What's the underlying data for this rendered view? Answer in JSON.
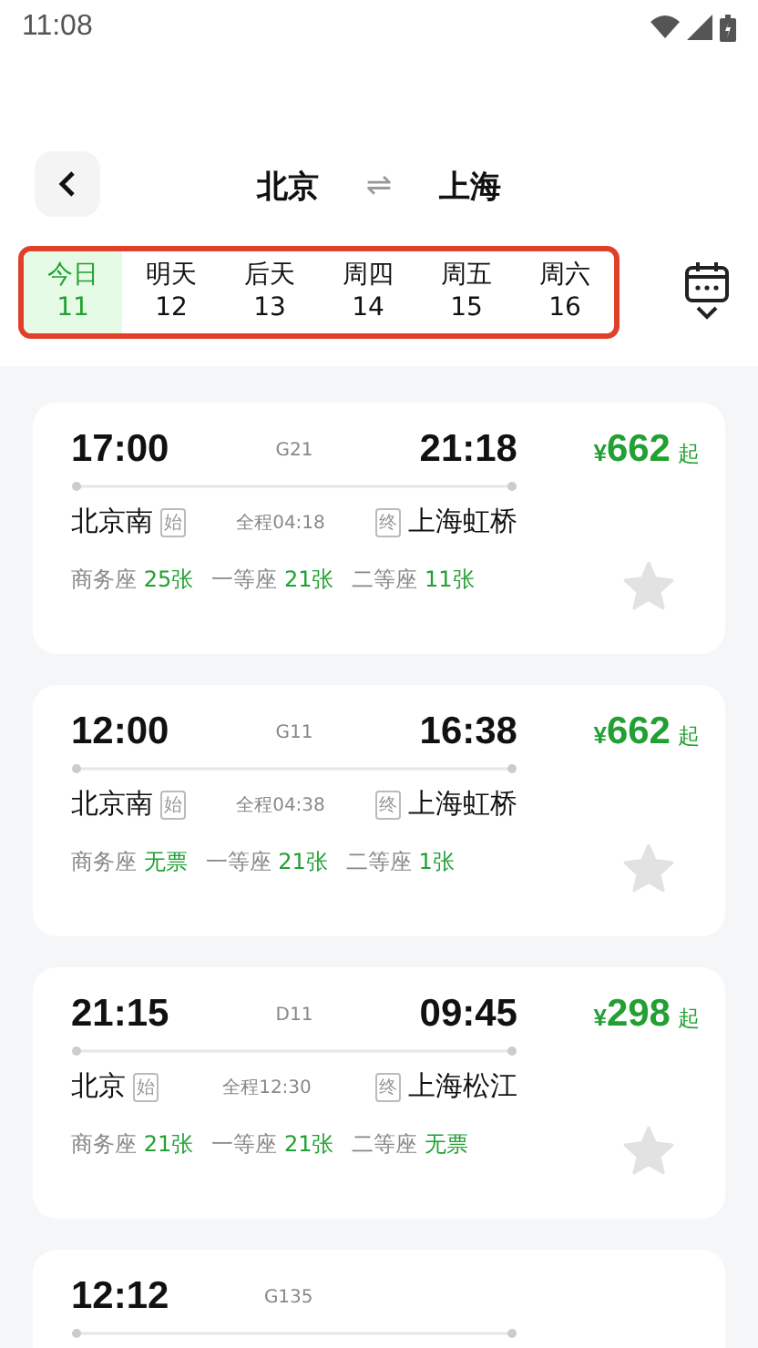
{
  "status_bar": {
    "time": "11:08"
  },
  "header": {
    "from": "北京",
    "swap": "⇌",
    "to": "上海"
  },
  "dates": [
    {
      "day": "今日",
      "date": "11",
      "selected": true
    },
    {
      "day": "明天",
      "date": "12",
      "selected": false
    },
    {
      "day": "后天",
      "date": "13",
      "selected": false
    },
    {
      "day": "周四",
      "date": "14",
      "selected": false
    },
    {
      "day": "周五",
      "date": "15",
      "selected": false
    },
    {
      "day": "周六",
      "date": "16",
      "selected": false
    }
  ],
  "trains": [
    {
      "depart": "17:00",
      "number": "G21",
      "arrive": "21:18",
      "currency": "¥",
      "price": "662",
      "price_suffix": "起",
      "from_station": "北京南",
      "from_tag": "始",
      "duration": "全程04:18",
      "to_tag": "终",
      "to_station": "上海虹桥",
      "favorited": false,
      "seats": [
        {
          "class": "商务座",
          "count": "25张"
        },
        {
          "class": "一等座",
          "count": "21张"
        },
        {
          "class": "二等座",
          "count": "11张"
        }
      ]
    },
    {
      "depart": "12:00",
      "number": "G11",
      "arrive": "16:38",
      "currency": "¥",
      "price": "662",
      "price_suffix": "起",
      "from_station": "北京南",
      "from_tag": "始",
      "duration": "全程04:38",
      "to_tag": "终",
      "to_station": "上海虹桥",
      "favorited": false,
      "seats": [
        {
          "class": "商务座",
          "count": "无票"
        },
        {
          "class": "一等座",
          "count": "21张"
        },
        {
          "class": "二等座",
          "count": "1张"
        }
      ]
    },
    {
      "depart": "21:15",
      "number": "D11",
      "arrive": "09:45",
      "currency": "¥",
      "price": "298",
      "price_suffix": "起",
      "from_station": "北京",
      "from_tag": "始",
      "duration": "全程12:30",
      "to_tag": "终",
      "to_station": "上海松江",
      "favorited": false,
      "seats": [
        {
          "class": "商务座",
          "count": "21张"
        },
        {
          "class": "一等座",
          "count": "21张"
        },
        {
          "class": "二等座",
          "count": "无票"
        }
      ]
    },
    {
      "depart": "12:12",
      "number": "G135"
    }
  ]
}
